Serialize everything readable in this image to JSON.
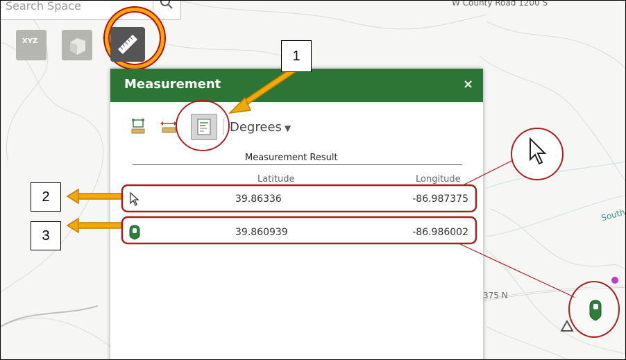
{
  "search": {
    "placeholder": "Search Space"
  },
  "map_labels": {
    "road_top": "W County Road 1200 S",
    "road_mid": "375 N",
    "south": "South"
  },
  "toolbar": {
    "xyz_label": "XYZ",
    "icons": [
      "coordinate-tool-icon",
      "3d-box-tool-icon",
      "ruler-measure-icon"
    ]
  },
  "panel": {
    "title": "Measurement",
    "close": "×",
    "tools": [
      "area-tool-icon",
      "distance-tool-icon",
      "location-tool-icon"
    ],
    "unit": "Degrees",
    "result_title": "Measurement Result",
    "columns": {
      "latitude": "Latitude",
      "longitude": "Longitude"
    },
    "rows": [
      {
        "icon": "cursor-icon",
        "latitude": "39.86336",
        "longitude": "-86.987375"
      },
      {
        "icon": "green-marker-icon",
        "latitude": "39.860939",
        "longitude": "-86.986002"
      }
    ]
  },
  "callouts": [
    "1",
    "2",
    "3"
  ],
  "colors": {
    "header": "#2d7534",
    "highlight": "#f2a900",
    "annotation": "#a81e1e",
    "marker": "#2e7d3a"
  }
}
